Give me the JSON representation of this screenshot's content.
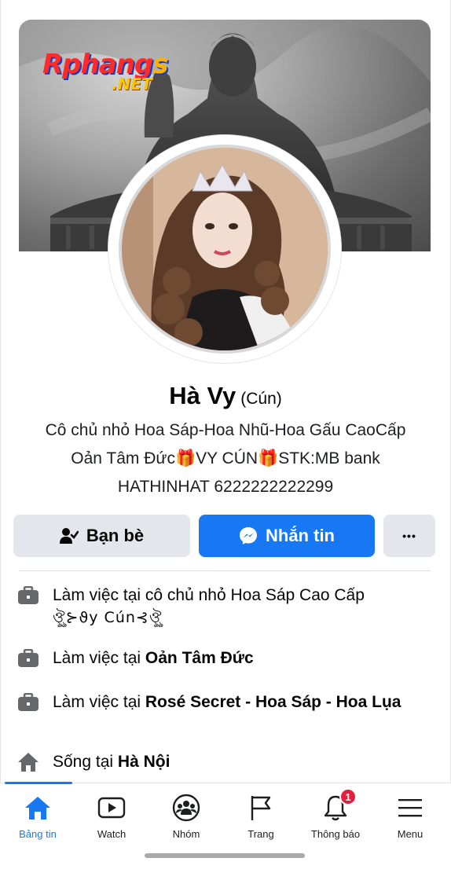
{
  "watermark": {
    "main": "Rphang",
    "main_end": "s",
    "sub": ".NET"
  },
  "profile": {
    "name": "Hà Vy",
    "nickname": "(Cún)",
    "bio_lines": [
      "Cô chủ nhỏ Hoa Sáp-Hoa Nhũ-Hoa Gấu CaoCấp",
      "Oản Tâm Đức🎁VY CÚN🎁STK:MB bank",
      "HATHINHAT 6222222222299"
    ]
  },
  "actions": {
    "friends_label": "Bạn bè",
    "message_label": "Nhắn tin",
    "more_label": "•••"
  },
  "details": [
    {
      "prefix": "Làm việc tại",
      "value": "cô chủ nhỏ Hoa Sáp Cao Cấp",
      "value2": "ঔৣ⊱ϑy Cún⊰ঔৣ",
      "icon": "briefcase-icon"
    },
    {
      "prefix": "Làm việc tại",
      "value": "Oản Tâm Đức",
      "icon": "briefcase-icon"
    },
    {
      "prefix": "Làm việc tại",
      "value": "Rosé Secret - Hoa Sáp - Hoa Lụa",
      "icon": "briefcase-icon"
    },
    {
      "prefix": "Sống tại",
      "value": "Hà Nội",
      "icon": "home-icon"
    }
  ],
  "nav": {
    "items": [
      {
        "label": "Bảng tin",
        "icon": "home-icon",
        "active": true
      },
      {
        "label": "Watch",
        "icon": "watch-icon"
      },
      {
        "label": "Nhóm",
        "icon": "groups-icon"
      },
      {
        "label": "Trang",
        "icon": "flag-icon"
      },
      {
        "label": "Thông báo",
        "icon": "bell-icon",
        "badge": "1"
      },
      {
        "label": "Menu",
        "icon": "menu-icon"
      }
    ]
  },
  "colors": {
    "accent": "#1877f2",
    "badge": "#e41e3f",
    "button_grey": "#e4e6eb"
  }
}
